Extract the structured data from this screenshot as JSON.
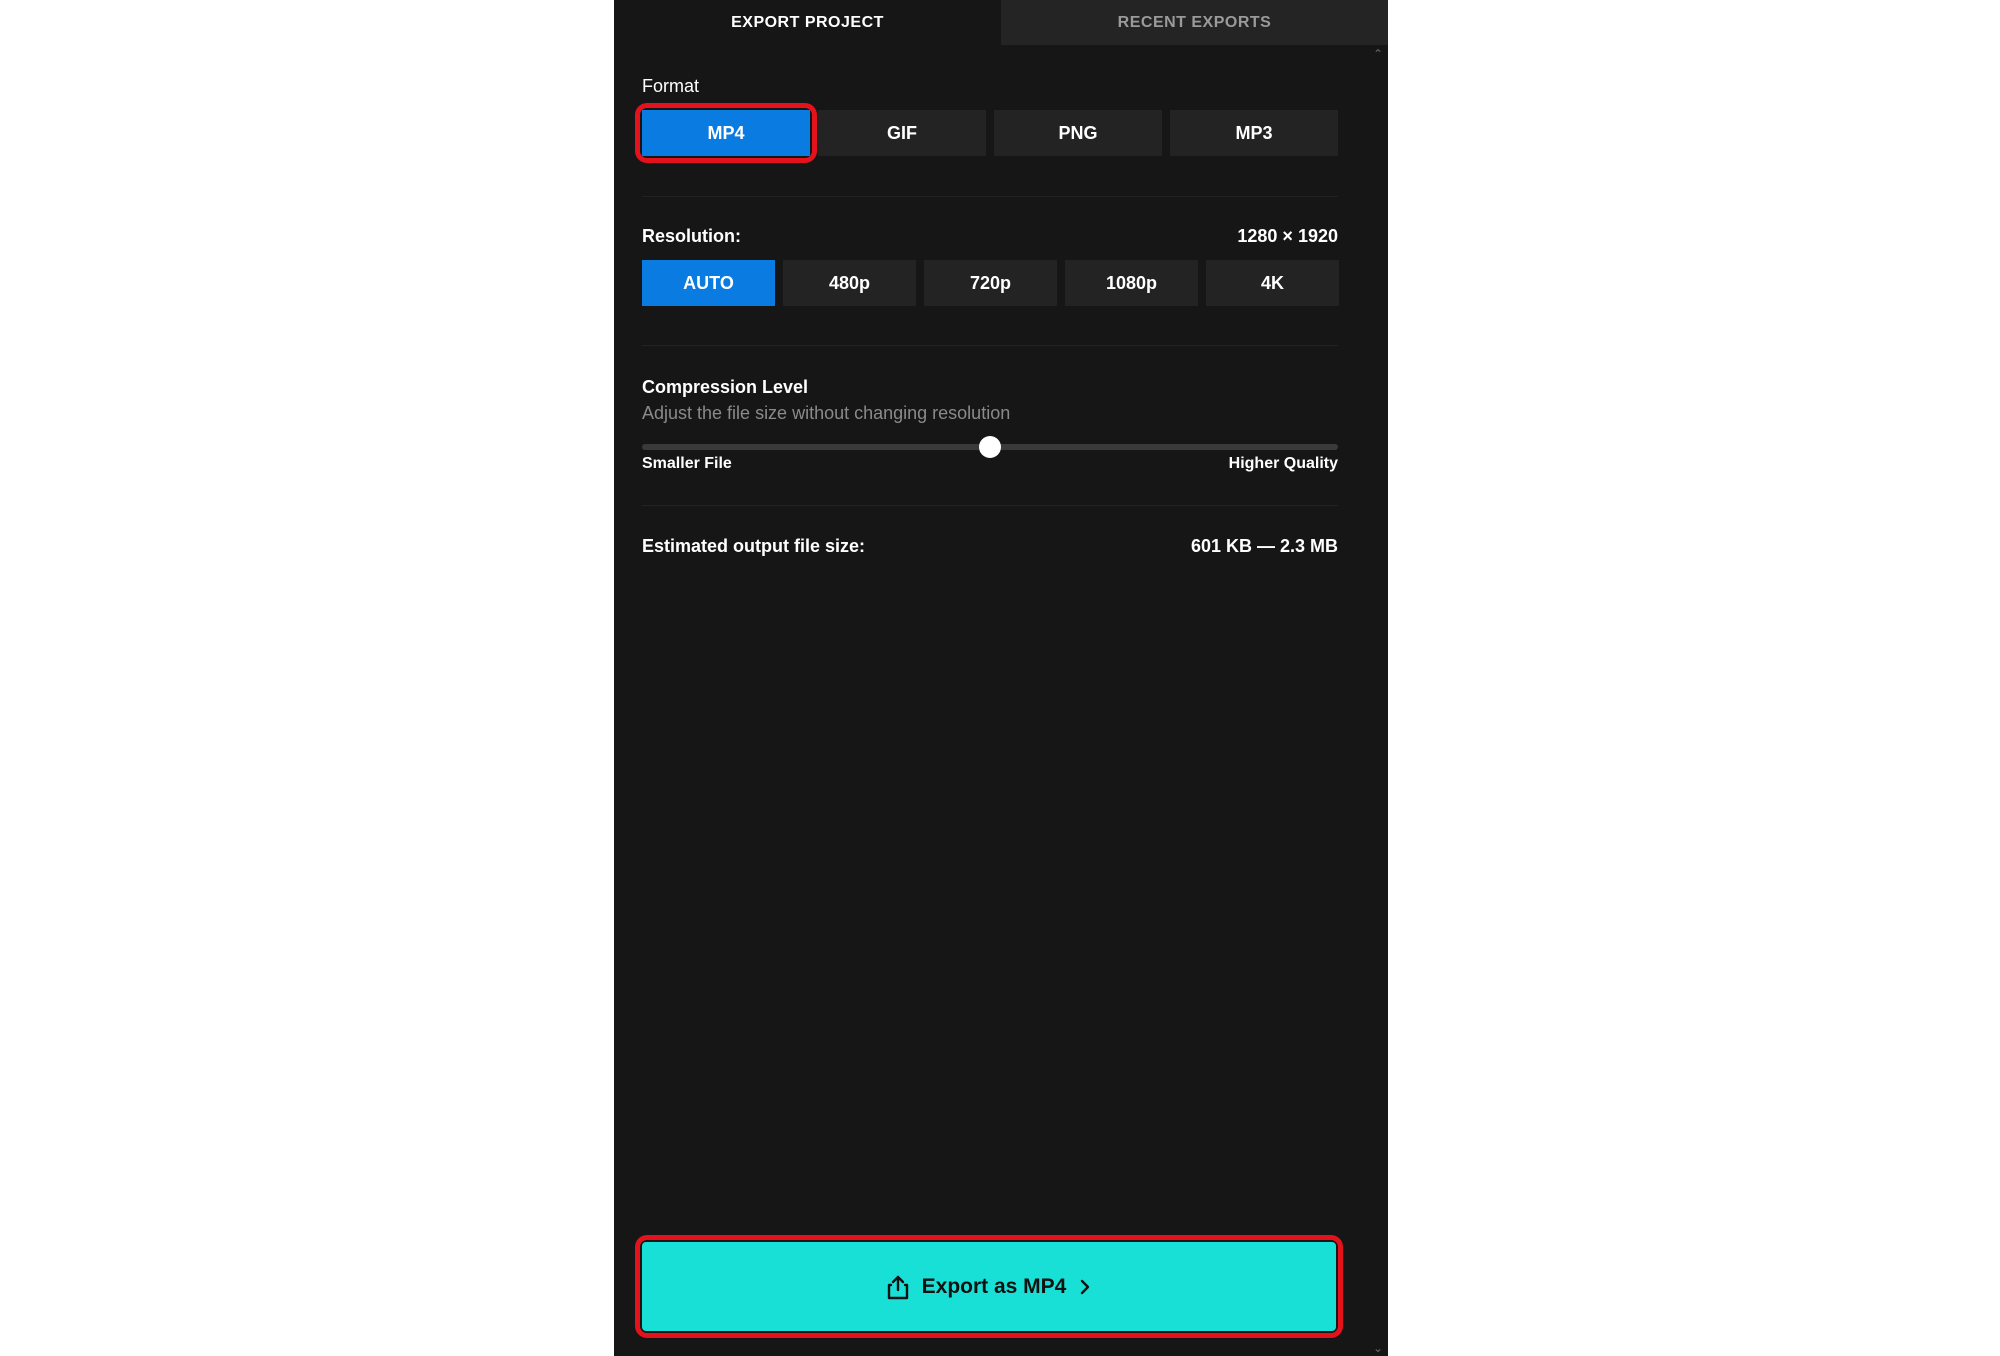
{
  "tabs": {
    "export_project": "EXPORT PROJECT",
    "recent_exports": "RECENT EXPORTS"
  },
  "format": {
    "label": "Format",
    "options": [
      "MP4",
      "GIF",
      "PNG",
      "MP3"
    ],
    "selected": "MP4"
  },
  "resolution": {
    "label": "Resolution:",
    "value": "1280 × 1920",
    "options": [
      "AUTO",
      "480p",
      "720p",
      "1080p",
      "4K"
    ],
    "selected": "AUTO"
  },
  "compression": {
    "title": "Compression Level",
    "subtitle": "Adjust the file size without changing resolution",
    "min_label": "Smaller File",
    "max_label": "Higher Quality",
    "level": 0.5
  },
  "estimate": {
    "label": "Estimated output file size:",
    "value": "601 KB — 2.3 MB"
  },
  "export_button": {
    "label": "Export as MP4",
    "icon": "share-upload-icon"
  },
  "colors": {
    "panel_bg": "#161616",
    "selected_blue": "#0a7be0",
    "export_teal": "#19e0d6",
    "highlight_red": "#e3121c"
  }
}
